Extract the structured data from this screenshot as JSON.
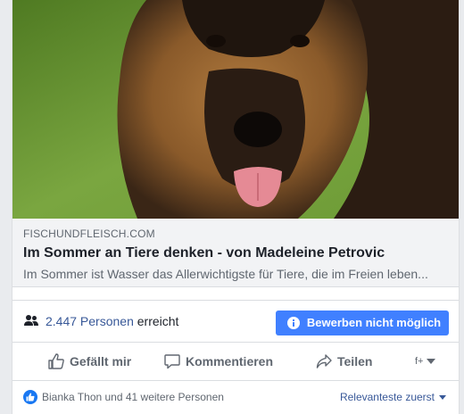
{
  "link_preview": {
    "image_subject": "German shepherd dog lying on grass",
    "domain": "FISCHUNDFLEISCH.COM",
    "title": "Im Sommer an Tiere denken - von Madeleine Petrovic",
    "description": "Im Sommer ist Wasser das Allerwichtigste für Tiere, die im Freien leben..."
  },
  "reach": {
    "count": "2.447 Personen",
    "suffix": "erreicht",
    "icon": "people-icon"
  },
  "boost": {
    "label": "Bewerben nicht möglich",
    "icon": "info-icon",
    "color": "#4080ff"
  },
  "actions": {
    "like": "Gefällt mir",
    "comment": "Kommentieren",
    "share": "Teilen",
    "picker_glyph": "f+"
  },
  "reactions": {
    "summary": "Bianka Thon und 41 weitere Personen",
    "sort_label": "Relevanteste zuerst",
    "like_color": "#1877f2"
  }
}
